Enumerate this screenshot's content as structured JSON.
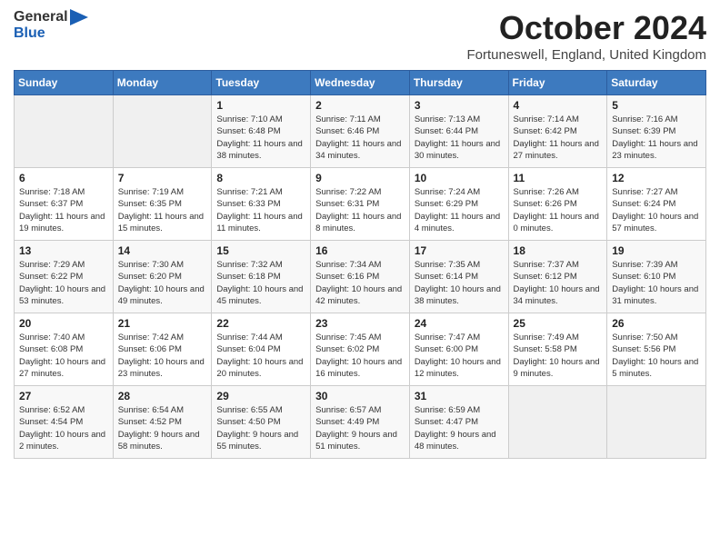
{
  "logo": {
    "text_general": "General",
    "text_blue": "Blue"
  },
  "header": {
    "month_title": "October 2024",
    "subtitle": "Fortuneswell, England, United Kingdom"
  },
  "days_of_week": [
    "Sunday",
    "Monday",
    "Tuesday",
    "Wednesday",
    "Thursday",
    "Friday",
    "Saturday"
  ],
  "weeks": [
    [
      {
        "day": "",
        "sunrise": "",
        "sunset": "",
        "daylight": ""
      },
      {
        "day": "",
        "sunrise": "",
        "sunset": "",
        "daylight": ""
      },
      {
        "day": "1",
        "sunrise": "Sunrise: 7:10 AM",
        "sunset": "Sunset: 6:48 PM",
        "daylight": "Daylight: 11 hours and 38 minutes."
      },
      {
        "day": "2",
        "sunrise": "Sunrise: 7:11 AM",
        "sunset": "Sunset: 6:46 PM",
        "daylight": "Daylight: 11 hours and 34 minutes."
      },
      {
        "day": "3",
        "sunrise": "Sunrise: 7:13 AM",
        "sunset": "Sunset: 6:44 PM",
        "daylight": "Daylight: 11 hours and 30 minutes."
      },
      {
        "day": "4",
        "sunrise": "Sunrise: 7:14 AM",
        "sunset": "Sunset: 6:42 PM",
        "daylight": "Daylight: 11 hours and 27 minutes."
      },
      {
        "day": "5",
        "sunrise": "Sunrise: 7:16 AM",
        "sunset": "Sunset: 6:39 PM",
        "daylight": "Daylight: 11 hours and 23 minutes."
      }
    ],
    [
      {
        "day": "6",
        "sunrise": "Sunrise: 7:18 AM",
        "sunset": "Sunset: 6:37 PM",
        "daylight": "Daylight: 11 hours and 19 minutes."
      },
      {
        "day": "7",
        "sunrise": "Sunrise: 7:19 AM",
        "sunset": "Sunset: 6:35 PM",
        "daylight": "Daylight: 11 hours and 15 minutes."
      },
      {
        "day": "8",
        "sunrise": "Sunrise: 7:21 AM",
        "sunset": "Sunset: 6:33 PM",
        "daylight": "Daylight: 11 hours and 11 minutes."
      },
      {
        "day": "9",
        "sunrise": "Sunrise: 7:22 AM",
        "sunset": "Sunset: 6:31 PM",
        "daylight": "Daylight: 11 hours and 8 minutes."
      },
      {
        "day": "10",
        "sunrise": "Sunrise: 7:24 AM",
        "sunset": "Sunset: 6:29 PM",
        "daylight": "Daylight: 11 hours and 4 minutes."
      },
      {
        "day": "11",
        "sunrise": "Sunrise: 7:26 AM",
        "sunset": "Sunset: 6:26 PM",
        "daylight": "Daylight: 11 hours and 0 minutes."
      },
      {
        "day": "12",
        "sunrise": "Sunrise: 7:27 AM",
        "sunset": "Sunset: 6:24 PM",
        "daylight": "Daylight: 10 hours and 57 minutes."
      }
    ],
    [
      {
        "day": "13",
        "sunrise": "Sunrise: 7:29 AM",
        "sunset": "Sunset: 6:22 PM",
        "daylight": "Daylight: 10 hours and 53 minutes."
      },
      {
        "day": "14",
        "sunrise": "Sunrise: 7:30 AM",
        "sunset": "Sunset: 6:20 PM",
        "daylight": "Daylight: 10 hours and 49 minutes."
      },
      {
        "day": "15",
        "sunrise": "Sunrise: 7:32 AM",
        "sunset": "Sunset: 6:18 PM",
        "daylight": "Daylight: 10 hours and 45 minutes."
      },
      {
        "day": "16",
        "sunrise": "Sunrise: 7:34 AM",
        "sunset": "Sunset: 6:16 PM",
        "daylight": "Daylight: 10 hours and 42 minutes."
      },
      {
        "day": "17",
        "sunrise": "Sunrise: 7:35 AM",
        "sunset": "Sunset: 6:14 PM",
        "daylight": "Daylight: 10 hours and 38 minutes."
      },
      {
        "day": "18",
        "sunrise": "Sunrise: 7:37 AM",
        "sunset": "Sunset: 6:12 PM",
        "daylight": "Daylight: 10 hours and 34 minutes."
      },
      {
        "day": "19",
        "sunrise": "Sunrise: 7:39 AM",
        "sunset": "Sunset: 6:10 PM",
        "daylight": "Daylight: 10 hours and 31 minutes."
      }
    ],
    [
      {
        "day": "20",
        "sunrise": "Sunrise: 7:40 AM",
        "sunset": "Sunset: 6:08 PM",
        "daylight": "Daylight: 10 hours and 27 minutes."
      },
      {
        "day": "21",
        "sunrise": "Sunrise: 7:42 AM",
        "sunset": "Sunset: 6:06 PM",
        "daylight": "Daylight: 10 hours and 23 minutes."
      },
      {
        "day": "22",
        "sunrise": "Sunrise: 7:44 AM",
        "sunset": "Sunset: 6:04 PM",
        "daylight": "Daylight: 10 hours and 20 minutes."
      },
      {
        "day": "23",
        "sunrise": "Sunrise: 7:45 AM",
        "sunset": "Sunset: 6:02 PM",
        "daylight": "Daylight: 10 hours and 16 minutes."
      },
      {
        "day": "24",
        "sunrise": "Sunrise: 7:47 AM",
        "sunset": "Sunset: 6:00 PM",
        "daylight": "Daylight: 10 hours and 12 minutes."
      },
      {
        "day": "25",
        "sunrise": "Sunrise: 7:49 AM",
        "sunset": "Sunset: 5:58 PM",
        "daylight": "Daylight: 10 hours and 9 minutes."
      },
      {
        "day": "26",
        "sunrise": "Sunrise: 7:50 AM",
        "sunset": "Sunset: 5:56 PM",
        "daylight": "Daylight: 10 hours and 5 minutes."
      }
    ],
    [
      {
        "day": "27",
        "sunrise": "Sunrise: 6:52 AM",
        "sunset": "Sunset: 4:54 PM",
        "daylight": "Daylight: 10 hours and 2 minutes."
      },
      {
        "day": "28",
        "sunrise": "Sunrise: 6:54 AM",
        "sunset": "Sunset: 4:52 PM",
        "daylight": "Daylight: 9 hours and 58 minutes."
      },
      {
        "day": "29",
        "sunrise": "Sunrise: 6:55 AM",
        "sunset": "Sunset: 4:50 PM",
        "daylight": "Daylight: 9 hours and 55 minutes."
      },
      {
        "day": "30",
        "sunrise": "Sunrise: 6:57 AM",
        "sunset": "Sunset: 4:49 PM",
        "daylight": "Daylight: 9 hours and 51 minutes."
      },
      {
        "day": "31",
        "sunrise": "Sunrise: 6:59 AM",
        "sunset": "Sunset: 4:47 PM",
        "daylight": "Daylight: 9 hours and 48 minutes."
      },
      {
        "day": "",
        "sunrise": "",
        "sunset": "",
        "daylight": ""
      },
      {
        "day": "",
        "sunrise": "",
        "sunset": "",
        "daylight": ""
      }
    ]
  ]
}
